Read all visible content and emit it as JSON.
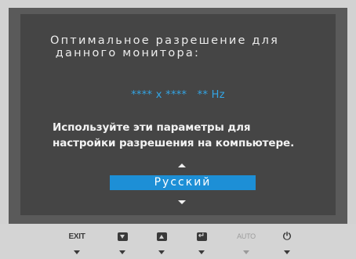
{
  "osd": {
    "heading": "Оптимальное разрешение для\n данного монитора:",
    "resolution_value": "**** x ****   ** Hz",
    "advice": "Используйте эти параметры для\nнастройки разрешения на компьютере.",
    "language_selected": "Русский"
  },
  "controls": {
    "exit_label": "EXIT",
    "auto_label": "AUTO",
    "down_icon": "triangle-down-icon",
    "up_icon": "triangle-up-icon",
    "enter_icon": "enter-icon",
    "power_icon": "power-icon",
    "enter_glyph": "↵",
    "power_glyph": "⏻"
  },
  "colors": {
    "screen_background": "#454545",
    "highlight": "#1d8fd6",
    "resolution_text": "#33a6e6",
    "bezel": "#d2d2d2",
    "auto_disabled": "#9c9c9c"
  }
}
